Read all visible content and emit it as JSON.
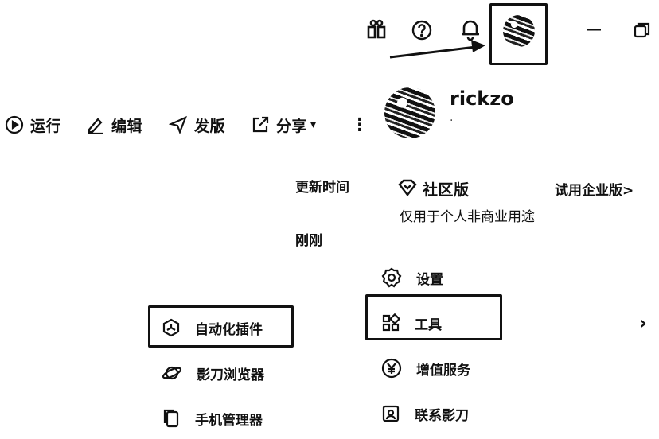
{
  "titlebar": {
    "icons": [
      "gift-icon",
      "help-icon",
      "bell-icon",
      "avatar",
      "minimize-icon",
      "restore-icon"
    ]
  },
  "toolbar": {
    "run_label": "运行",
    "edit_label": "编辑",
    "publish_label": "发版",
    "share_label": "分享",
    "share_caret": "▾",
    "more_label": "⋮"
  },
  "background": {
    "update_time_label": "更新时间",
    "time_value": "刚刚"
  },
  "profile": {
    "username": "rickzo",
    "user_id": "·",
    "plan_name": "社区版",
    "plan_desc": "仅用于个人非商业用途",
    "trial_link": "试用企业版>"
  },
  "menu": {
    "settings": "设置",
    "tools": "工具",
    "value_added": "增值服务",
    "contact": "联系影刀",
    "chevron": "›"
  },
  "submenu": {
    "automation_plugin": "自动化插件",
    "browser": "影刀浏览器",
    "phone_manager": "手机管理器"
  }
}
